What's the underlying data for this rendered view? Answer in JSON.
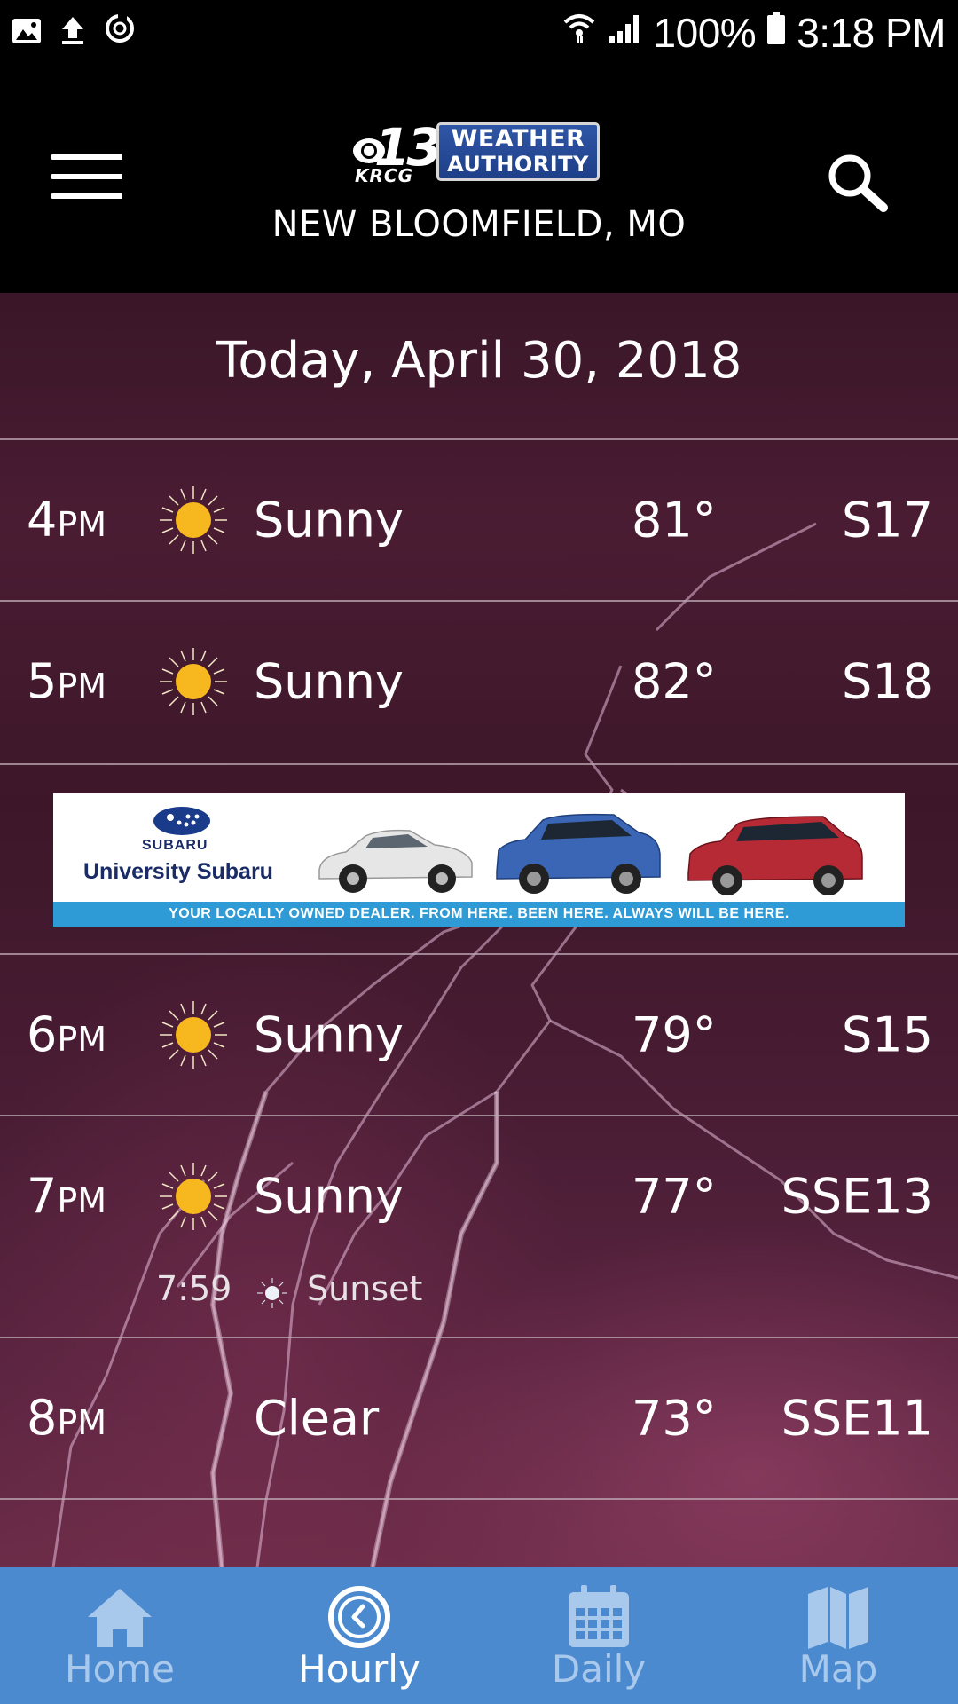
{
  "status_bar": {
    "battery": "100%",
    "time": "3:18 PM"
  },
  "header": {
    "logo": {
      "number": "13",
      "station": "KRCG",
      "line1": "WEATHER",
      "line2": "AUTHORITY"
    },
    "location": "NEW BLOOMFIELD, MO"
  },
  "date_header": "Today, April 30, 2018",
  "hours": [
    {
      "hour": "4",
      "ampm": "PM",
      "icon": "sun-icon",
      "condition": "Sunny",
      "temp": "81°",
      "wind": "S17"
    },
    {
      "hour": "5",
      "ampm": "PM",
      "icon": "sun-icon",
      "condition": "Sunny",
      "temp": "82°",
      "wind": "S18"
    },
    {
      "hour": "6",
      "ampm": "PM",
      "icon": "sun-icon",
      "condition": "Sunny",
      "temp": "79°",
      "wind": "S15"
    },
    {
      "hour": "7",
      "ampm": "PM",
      "icon": "sun-icon",
      "condition": "Sunny",
      "temp": "77°",
      "wind": "SSE13"
    },
    {
      "hour": "8",
      "ampm": "PM",
      "icon": "moon-icon",
      "condition": "Clear",
      "temp": "73°",
      "wind": "SSE11"
    }
  ],
  "sunset": {
    "time": "7:59",
    "label": "Sunset"
  },
  "ad": {
    "brand": "SUBARU",
    "dealer": "University Subaru",
    "tagline": "YOUR LOCALLY OWNED DEALER. FROM HERE. BEEN HERE. ALWAYS WILL BE HERE.",
    "car_colors": [
      "#e8e8e8",
      "#3a66b5",
      "#b52a35"
    ]
  },
  "nav": [
    {
      "label": "Home",
      "icon": "home-icon",
      "active": false
    },
    {
      "label": "Hourly",
      "icon": "clock-icon",
      "active": true
    },
    {
      "label": "Daily",
      "icon": "calendar-icon",
      "active": false
    },
    {
      "label": "Map",
      "icon": "map-icon",
      "active": false
    }
  ],
  "colors": {
    "nav_bg": "#4c8ad0",
    "nav_inactive": "#a9c9ec",
    "sun": "#f7b81f",
    "moon": "#c9b98a"
  }
}
